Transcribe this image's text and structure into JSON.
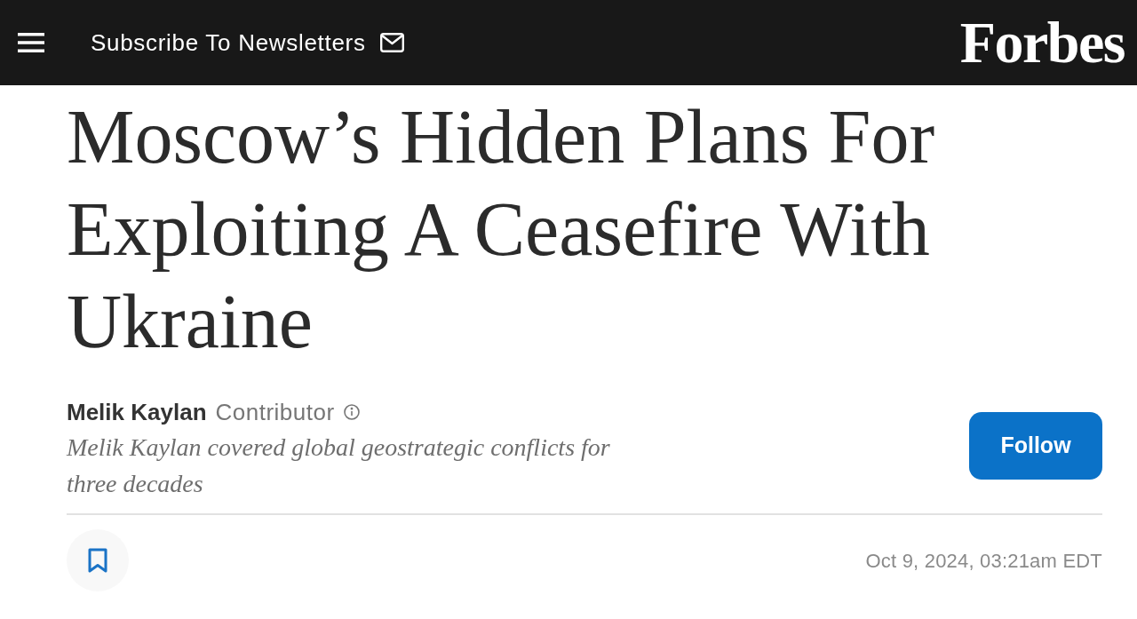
{
  "header": {
    "newsletter_link": "Subscribe To Newsletters",
    "logo": "Forbes"
  },
  "article": {
    "headline": "Moscow’s Hidden Plans For Exploiting A Ceasefire With Ukraine",
    "author": {
      "name": "Melik Kaylan",
      "role": "Contributor",
      "bio": "Melik Kaylan covered global geostrategic conflicts for three decades"
    },
    "follow_button": "Follow",
    "timestamp": "Oct 9, 2024, 03:21am EDT"
  }
}
